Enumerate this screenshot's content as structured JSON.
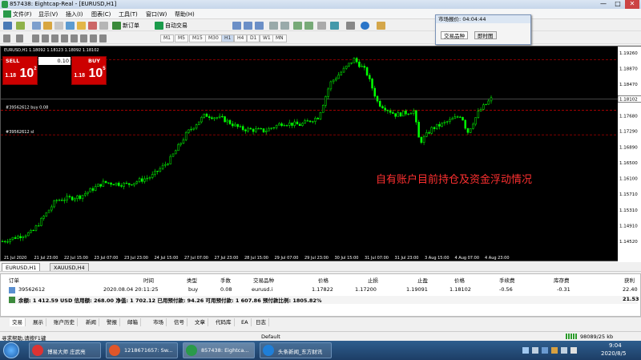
{
  "window": {
    "title": "857438: Eightcap-Real - [EURUSD,H1]",
    "min": "—",
    "max": "□",
    "close": "✕"
  },
  "menu": [
    "文件(F)",
    "显示(V)",
    "插入(I)",
    "图表(C)",
    "工具(T)",
    "窗口(W)",
    "帮助(H)"
  ],
  "toolbar": {
    "new_order": "新订单",
    "auto_trading": "自动交易",
    "timeframes": [
      "M1",
      "M5",
      "M15",
      "M30",
      "H1",
      "H4",
      "D1",
      "W1",
      "MN"
    ]
  },
  "market_watch": {
    "title": "市场报价: 04:04:44",
    "tabs": [
      "交易品种",
      "即时图"
    ]
  },
  "chart": {
    "symbol_info": "EURUSD,H1  1.18092 1.18123 1.18092 1.18102",
    "annotation": "自有账户目前持仓及资金浮动情况",
    "order_line_buy": "#39562612 buy 0.08",
    "order_line_sl": "#39562612 sl",
    "current_price": "1.18102",
    "price_labels": [
      "1.19260",
      "1.18870",
      "1.18470",
      "1.18102",
      "1.17680",
      "1.17290",
      "1.16890",
      "1.16500",
      "1.16100",
      "1.15710",
      "1.15310",
      "1.14910",
      "1.14520"
    ],
    "time_labels": [
      "21 Jul 2020",
      "21 Jul 23:00",
      "22 Jul 15:00",
      "23 Jul 07:00",
      "23 Jul 23:00",
      "24 Jul 15:00",
      "27 Jul 07:00",
      "27 Jul 23:00",
      "28 Jul 15:00",
      "29 Jul 07:00",
      "29 Jul 23:00",
      "30 Jul 15:00",
      "31 Jul 07:00",
      "31 Jul 23:00",
      "3 Aug 15:00",
      "4 Aug 07:00",
      "4 Aug 23:00"
    ],
    "colors": {
      "bull": "#00ff00",
      "bear": "#00ff00",
      "grid_line": "#ff0000",
      "annotation": "#ff3030"
    }
  },
  "one_click": {
    "sell_label": "SELL",
    "buy_label": "BUY",
    "volume": "0.10",
    "sell_prefix": "1.18",
    "sell_big": "10",
    "sell_sup": "2",
    "buy_prefix": "1.18",
    "buy_big": "10",
    "buy_sup": "5"
  },
  "chart_tabs": [
    "EURUSD,H1",
    "XAUUSD,H4"
  ],
  "terminal": {
    "headers": [
      "订单",
      "时间",
      "类型",
      "手数",
      "交易品种",
      "价格",
      "止损",
      "止盈",
      "价格",
      "手续费",
      "库存费",
      "获利"
    ],
    "row": {
      "order": "39562612",
      "time": "2020.08.04 20:11:25",
      "type": "buy",
      "lots": "0.08",
      "symbol": "eurusd.i",
      "price": "1.17822",
      "sl": "1.17200",
      "tp": "1.19091",
      "cur_price": "1.18102",
      "commission": "-0.56",
      "swap": "-0.31",
      "profit": "22.40"
    },
    "summary": "余额: 1 412.59 USD  信用额: 268.00  净值: 1 702.12  已用预付款: 94.26  可用预付款: 1 607.86  预付款比例: 1805.82%",
    "summary_profit": "21.53"
  },
  "terminal_tabs": [
    "交易",
    "展示",
    "账户历史",
    "新闻",
    "警报",
    "邮箱",
    "市场",
    "信号",
    "文章",
    "代码库",
    "EA",
    "日志"
  ],
  "status": {
    "help": "寻求帮助,请按F1键",
    "profile": "Default",
    "traffic": "98089/25 kb"
  },
  "taskbar": {
    "items": [
      "博易大师 庄武亮",
      "1218671657: Sw...",
      "857438: Eightca...",
      "头条新闻_东方财讯"
    ],
    "time": "9:04",
    "date": "2020/8/5"
  }
}
